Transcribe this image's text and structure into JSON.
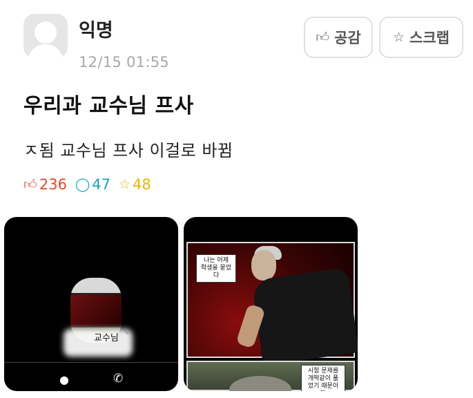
{
  "post": {
    "author": "익명",
    "timestamp": "12/15 01:55",
    "title": "우리과 교수님 프사",
    "content": "ㅈ됨 교수님 프사 이걸로 바뀜"
  },
  "actions": {
    "like_label": "공감",
    "scrap_label": "스크랩"
  },
  "stats": {
    "likes": "236",
    "comments": "47",
    "scraps": "48"
  },
  "colors": {
    "like": "#e0492f",
    "comment": "#12a8b8",
    "scrap": "#e6b800"
  },
  "icons": {
    "like": "thumbs-up-icon",
    "comment": "comment-bubble-icon",
    "scrap": "star-icon",
    "chat": "chat-icon",
    "call": "phone-icon"
  },
  "images": [
    {
      "profile_name": "교수님"
    },
    {
      "caption_top": "나는 어제 학생을 묻었다",
      "caption_bottom": "시험 문제를 개떡같이 풀었기 때문이다"
    }
  ]
}
